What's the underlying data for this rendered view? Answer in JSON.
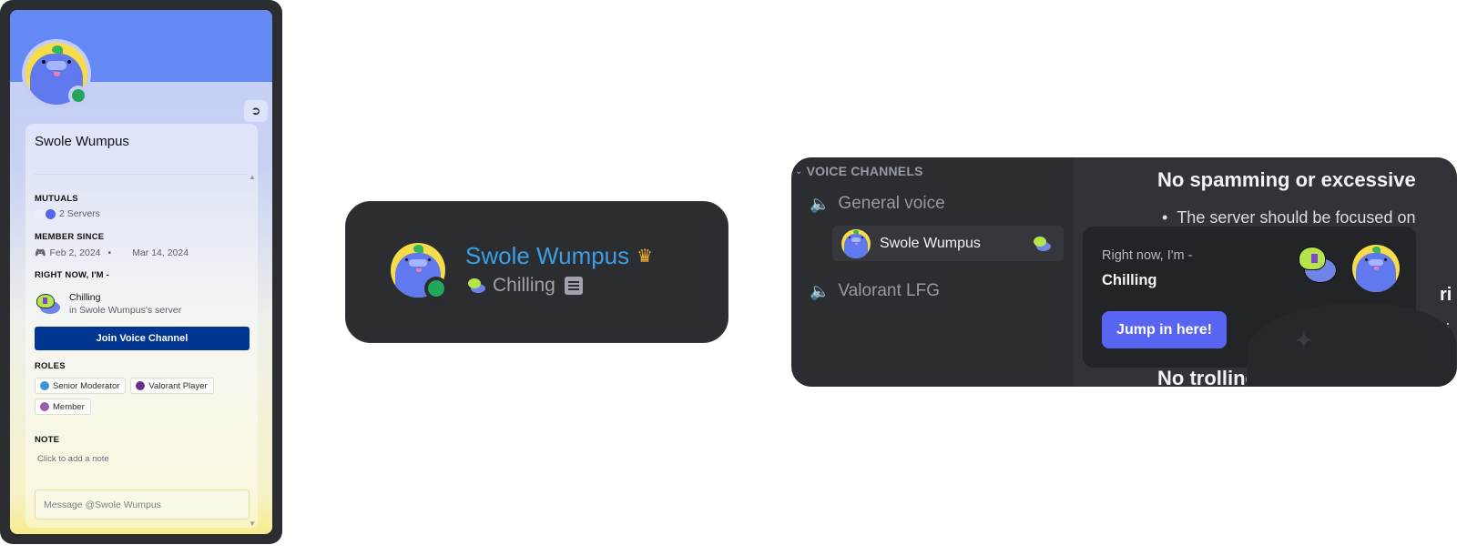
{
  "profile_card": {
    "username": "Swole Wumpus",
    "status_color": "#23a55a",
    "banner_color": "#6589f4",
    "nitro_icon": "nitro-wheel-icon",
    "mutuals": {
      "title": "MUTUALS",
      "value": "2 Servers"
    },
    "member_since": {
      "title": "MEMBER SINCE",
      "discord_date": "Feb 2, 2024",
      "separator": "•",
      "server_date": "Mar 14, 2024"
    },
    "activity": {
      "title": "RIGHT NOW, I'M -",
      "name": "Chilling",
      "location": "in Swole Wumpus's server"
    },
    "join_button": "Join Voice Channel",
    "roles": {
      "title": "ROLES",
      "items": [
        {
          "name": "Senior Moderator",
          "color": "#3b96d8"
        },
        {
          "name": "Valorant Player",
          "color": "#6e2b8e"
        },
        {
          "name": "Member",
          "color": "#9b59b6"
        }
      ]
    },
    "note": {
      "title": "NOTE",
      "placeholder": "Click to add a note"
    },
    "message_placeholder": "Message @Swole Wumpus"
  },
  "member_row": {
    "name": "Swole Wumpus",
    "name_color": "#3c9fe3",
    "crown_icon": "crown-icon",
    "activity": "Chilling",
    "activity_icon": "document-icon"
  },
  "voice_panel": {
    "category": "VOICE CHANNELS",
    "channels": [
      {
        "name": "General voice",
        "users": [
          {
            "name": "Swole Wumpus"
          }
        ]
      },
      {
        "name": "Valorant LFG",
        "users": []
      }
    ],
    "chat": {
      "heading_1": "No spamming or excessive",
      "bullet_1": "The server should be focused on",
      "heading_2": "No trolling or harassment",
      "fragment_1": "ri",
      "fragment_2": "ri"
    },
    "popup": {
      "label": "Right now, I'm -",
      "title": "Chilling",
      "button": "Jump in here!"
    }
  }
}
